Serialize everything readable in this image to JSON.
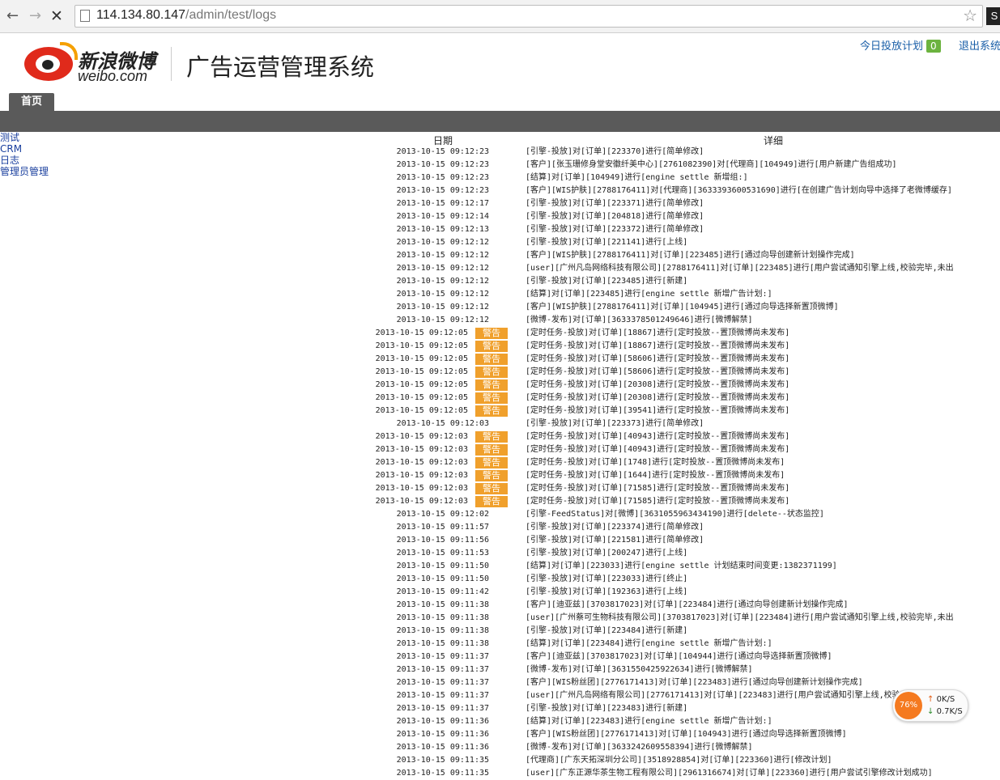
{
  "browser": {
    "url_host": "114.134.80.147",
    "url_path": "/admin/test/logs",
    "extension_label": "S"
  },
  "header": {
    "brand_cn": "新浪微博",
    "brand_en": "weibo.com",
    "system_title": "广告运营管理系统",
    "today_plan_label": "今日投放计划",
    "today_plan_count": "0",
    "logout_label": "退出系统"
  },
  "nav": {
    "home_tab": "首页"
  },
  "sidebar": {
    "items": [
      "测试",
      "CRM",
      "日志",
      "管理员管理"
    ]
  },
  "log": {
    "col_date": "日期",
    "col_detail": "详细",
    "level_label": "警告",
    "rows": [
      {
        "time": "2013-10-15 09:12:23",
        "warn": false,
        "detail": "[引擎-投放]对[订单][223370]进行[简单修改]"
      },
      {
        "time": "2013-10-15 09:12:23",
        "warn": false,
        "detail": "[客户][张玉珊修身堂安徽纤美中心][2761082390]对[代理商][104949]进行[用户新建广告组成功]"
      },
      {
        "time": "2013-10-15 09:12:23",
        "warn": false,
        "detail": "[结算]对[订单][104949]进行[engine settle 新增组:]"
      },
      {
        "time": "2013-10-15 09:12:23",
        "warn": false,
        "detail": "[客户][WIS护肤][2788176411]对[代理商][3633393600531690]进行[在创建广告计划向导中选择了老微博缓存]"
      },
      {
        "time": "2013-10-15 09:12:17",
        "warn": false,
        "detail": "[引擎-投放]对[订单][223371]进行[简单修改]"
      },
      {
        "time": "2013-10-15 09:12:14",
        "warn": false,
        "detail": "[引擎-投放]对[订单][204818]进行[简单修改]"
      },
      {
        "time": "2013-10-15 09:12:13",
        "warn": false,
        "detail": "[引擎-投放]对[订单][223372]进行[简单修改]"
      },
      {
        "time": "2013-10-15 09:12:12",
        "warn": false,
        "detail": "[引擎-投放]对[订单][221141]进行[上线]"
      },
      {
        "time": "2013-10-15 09:12:12",
        "warn": false,
        "detail": "[客户][WIS护肤][2788176411]对[订单][223485]进行[通过向导创建新计划操作完成]"
      },
      {
        "time": "2013-10-15 09:12:12",
        "warn": false,
        "detail": "[user][广州凡岛网络科技有限公司][2788176411]对[订单][223485]进行[用户尝试通知引擎上线,校验完毕,未出"
      },
      {
        "time": "2013-10-15 09:12:12",
        "warn": false,
        "detail": "[引擎-投放]对[订单][223485]进行[新建]"
      },
      {
        "time": "2013-10-15 09:12:12",
        "warn": false,
        "detail": "[结算]对[订单][223485]进行[engine settle 新增广告计划:]"
      },
      {
        "time": "2013-10-15 09:12:12",
        "warn": false,
        "detail": "[客户][WIS护肤][2788176411]对[订单][104945]进行[通过向导选择新置顶微博]"
      },
      {
        "time": "2013-10-15 09:12:12",
        "warn": false,
        "detail": "[微博-发布]对[订单][3633378501249646]进行[微博解禁]"
      },
      {
        "time": "2013-10-15 09:12:05",
        "warn": true,
        "detail": "[定时任务-投放]对[订单][18867]进行[定时投放--置顶微博尚未发布]"
      },
      {
        "time": "2013-10-15 09:12:05",
        "warn": true,
        "detail": "[定时任务-投放]对[订单][18867]进行[定时投放--置顶微博尚未发布]"
      },
      {
        "time": "2013-10-15 09:12:05",
        "warn": true,
        "detail": "[定时任务-投放]对[订单][58606]进行[定时投放--置顶微博尚未发布]"
      },
      {
        "time": "2013-10-15 09:12:05",
        "warn": true,
        "detail": "[定时任务-投放]对[订单][58606]进行[定时投放--置顶微博尚未发布]"
      },
      {
        "time": "2013-10-15 09:12:05",
        "warn": true,
        "detail": "[定时任务-投放]对[订单][20308]进行[定时投放--置顶微博尚未发布]"
      },
      {
        "time": "2013-10-15 09:12:05",
        "warn": true,
        "detail": "[定时任务-投放]对[订单][20308]进行[定时投放--置顶微博尚未发布]"
      },
      {
        "time": "2013-10-15 09:12:05",
        "warn": true,
        "detail": "[定时任务-投放]对[订单][39541]进行[定时投放--置顶微博尚未发布]"
      },
      {
        "time": "2013-10-15 09:12:03",
        "warn": false,
        "detail": "[引擎-投放]对[订单][223373]进行[简单修改]"
      },
      {
        "time": "2013-10-15 09:12:03",
        "warn": true,
        "detail": "[定时任务-投放]对[订单][40943]进行[定时投放--置顶微博尚未发布]"
      },
      {
        "time": "2013-10-15 09:12:03",
        "warn": true,
        "detail": "[定时任务-投放]对[订单][40943]进行[定时投放--置顶微博尚未发布]"
      },
      {
        "time": "2013-10-15 09:12:03",
        "warn": true,
        "detail": "[定时任务-投放]对[订单][1748]进行[定时投放--置顶微博尚未发布]"
      },
      {
        "time": "2013-10-15 09:12:03",
        "warn": true,
        "detail": "[定时任务-投放]对[订单][1644]进行[定时投放--置顶微博尚未发布]"
      },
      {
        "time": "2013-10-15 09:12:03",
        "warn": true,
        "detail": "[定时任务-投放]对[订单][71585]进行[定时投放--置顶微博尚未发布]"
      },
      {
        "time": "2013-10-15 09:12:03",
        "warn": true,
        "detail": "[定时任务-投放]对[订单][71585]进行[定时投放--置顶微博尚未发布]"
      },
      {
        "time": "2013-10-15 09:12:02",
        "warn": false,
        "detail": "[引擎-FeedStatus]对[微博][3631055963434190]进行[delete--状态监控]"
      },
      {
        "time": "2013-10-15 09:11:57",
        "warn": false,
        "detail": "[引擎-投放]对[订单][223374]进行[简单修改]"
      },
      {
        "time": "2013-10-15 09:11:56",
        "warn": false,
        "detail": "[引擎-投放]对[订单][221581]进行[简单修改]"
      },
      {
        "time": "2013-10-15 09:11:53",
        "warn": false,
        "detail": "[引擎-投放]对[订单][200247]进行[上线]"
      },
      {
        "time": "2013-10-15 09:11:50",
        "warn": false,
        "detail": "[结算]对[订单][223033]进行[engine settle 计划结束时间变更:1382371199]"
      },
      {
        "time": "2013-10-15 09:11:50",
        "warn": false,
        "detail": "[引擎-投放]对[订单][223033]进行[终止]"
      },
      {
        "time": "2013-10-15 09:11:42",
        "warn": false,
        "detail": "[引擎-投放]对[订单][192363]进行[上线]"
      },
      {
        "time": "2013-10-15 09:11:38",
        "warn": false,
        "detail": "[客户][迪亚兹][3703817023]对[订单][223484]进行[通过向导创建新计划操作完成]"
      },
      {
        "time": "2013-10-15 09:11:38",
        "warn": false,
        "detail": "[user][广州蔡可生物科技有限公司][3703817023]对[订单][223484]进行[用户尝试通知引擎上线,校验完毕,未出"
      },
      {
        "time": "2013-10-15 09:11:38",
        "warn": false,
        "detail": "[引擎-投放]对[订单][223484]进行[新建]"
      },
      {
        "time": "2013-10-15 09:11:38",
        "warn": false,
        "detail": "[结算]对[订单][223484]进行[engine settle 新增广告计划:]"
      },
      {
        "time": "2013-10-15 09:11:37",
        "warn": false,
        "detail": "[客户][迪亚兹][3703817023]对[订单][104944]进行[通过向导选择新置顶微博]"
      },
      {
        "time": "2013-10-15 09:11:37",
        "warn": false,
        "detail": "[微博-发布]对[订单][3631550425922634]进行[微博解禁]"
      },
      {
        "time": "2013-10-15 09:11:37",
        "warn": false,
        "detail": "[客户][WIS粉丝团][2776171413]对[订单][223483]进行[通过向导创建新计划操作完成]"
      },
      {
        "time": "2013-10-15 09:11:37",
        "warn": false,
        "detail": "[user][广州凡岛网络有限公司][2776171413]对[订单][223483]进行[用户尝试通知引擎上线,校验完毕,未出错]"
      },
      {
        "time": "2013-10-15 09:11:37",
        "warn": false,
        "detail": "[引擎-投放]对[订单][223483]进行[新建]"
      },
      {
        "time": "2013-10-15 09:11:36",
        "warn": false,
        "detail": "[结算]对[订单][223483]进行[engine settle 新增广告计划:]"
      },
      {
        "time": "2013-10-15 09:11:36",
        "warn": false,
        "detail": "[客户][WIS粉丝团][2776171413]对[订单][104943]进行[通过向导选择新置顶微博]"
      },
      {
        "time": "2013-10-15 09:11:36",
        "warn": false,
        "detail": "[微博-发布]对[订单][3633242609558394]进行[微博解禁]"
      },
      {
        "time": "2013-10-15 09:11:35",
        "warn": false,
        "detail": "[代理商][广东天拓深圳分公司][3518928854]对[订单][223360]进行[修改计划]"
      },
      {
        "time": "2013-10-15 09:11:35",
        "warn": false,
        "detail": "[user][广东正源华茶生物工程有限公司][2961316674]对[订单][223360]进行[用户尝试引擎修改计划成功]"
      }
    ]
  },
  "speed_widget": {
    "percent": "76%",
    "upload": "0K/S",
    "download": "0.7K/S"
  }
}
